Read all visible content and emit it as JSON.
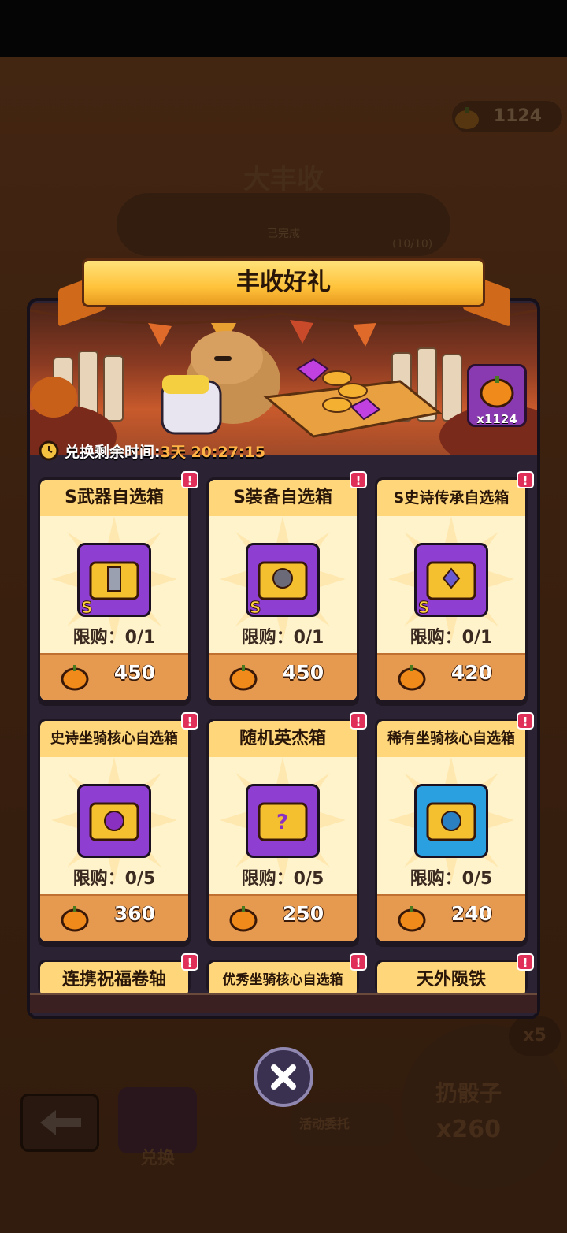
{
  "background": {
    "pumpkin_count": "1124",
    "event_title": "大丰收",
    "progress_label": "已完成",
    "progress_count": "(10/10)",
    "exchange_label": "兑换",
    "task_label": "活动委托",
    "dice_label": "扔骰子",
    "dice_count": "x260",
    "multiplier": "x5"
  },
  "dialog": {
    "title": "丰收好礼",
    "currency_count": "x1124",
    "timer_label": "兑换剩余时间:",
    "timer_value": "3天 20:27:15"
  },
  "items": [
    {
      "title": "S武器自选箱",
      "limit": "限购：0/1",
      "price": "450",
      "icon": "s-weapon-chest-icon",
      "rank": "S",
      "color": "purple"
    },
    {
      "title": "S装备自选箱",
      "limit": "限购：0/1",
      "price": "450",
      "icon": "s-gear-chest-icon",
      "rank": "S",
      "color": "purple"
    },
    {
      "title": "S史诗传承自选箱",
      "limit": "限购：0/1",
      "price": "420",
      "icon": "s-epic-legacy-chest-icon",
      "rank": "S",
      "color": "purple"
    },
    {
      "title": "史诗坐骑核心自选箱",
      "limit": "限购：0/5",
      "price": "360",
      "icon": "epic-mount-core-chest-icon",
      "rank": "",
      "color": "purple"
    },
    {
      "title": "随机英杰箱",
      "limit": "限购：0/5",
      "price": "250",
      "icon": "random-hero-chest-icon",
      "rank": "",
      "color": "purple"
    },
    {
      "title": "稀有坐骑核心自选箱",
      "limit": "限购：0/5",
      "price": "240",
      "icon": "rare-mount-core-chest-icon",
      "rank": "",
      "color": "blue"
    },
    {
      "title": "连携祝福卷轴",
      "limit": "",
      "price": "",
      "icon": "",
      "rank": "",
      "color": "purple"
    },
    {
      "title": "优秀坐骑核心自选箱",
      "limit": "",
      "price": "",
      "icon": "",
      "rank": "",
      "color": "purple"
    },
    {
      "title": "天外陨铁",
      "limit": "",
      "price": "",
      "icon": "",
      "rank": "",
      "color": "purple"
    }
  ],
  "badge_symbol": "!",
  "colors": {
    "card_bg": "#fff3cc",
    "card_head": "#ffd67a",
    "price_bar": "#e59a50",
    "ribbon": "#ffc23a",
    "timer_accent": "#ffb347",
    "badge": "#e0305a"
  }
}
